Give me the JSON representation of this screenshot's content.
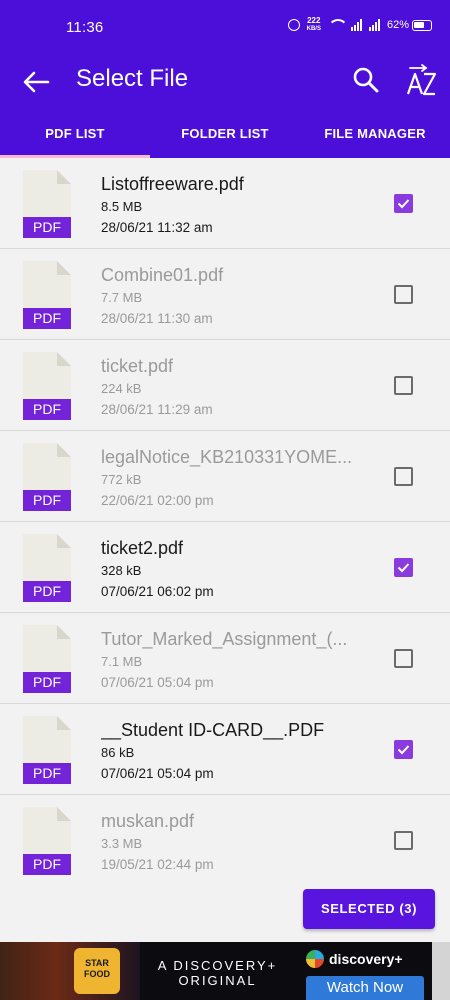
{
  "statusbar": {
    "time": "11:36",
    "speed_value": "222",
    "speed_unit": "KB/S",
    "battery": "62%"
  },
  "appbar": {
    "title": "Select File",
    "back_icon": "arrow-left-icon",
    "search_icon": "search-icon",
    "sort_icon": "sort-az-icon",
    "sort_label": "AZ"
  },
  "tabs": [
    {
      "label": "PDF LIST",
      "active": true
    },
    {
      "label": "FOLDER LIST",
      "active": false
    },
    {
      "label": "FILE MANAGER",
      "active": false
    }
  ],
  "files": [
    {
      "name": "Listoffreeware.pdf",
      "size": "8.5 MB",
      "date": "28/06/21  11:32 am",
      "checked": true
    },
    {
      "name": "Combine01.pdf",
      "size": "7.7 MB",
      "date": "28/06/21  11:30 am",
      "checked": false
    },
    {
      "name": "ticket.pdf",
      "size": "224 kB",
      "date": "28/06/21  11:29 am",
      "checked": false
    },
    {
      "name": "legalNotice_KB210331YOME...",
      "size": "772 kB",
      "date": "22/06/21  02:00 pm",
      "checked": false
    },
    {
      "name": "ticket2.pdf",
      "size": "328 kB",
      "date": "07/06/21  06:02 pm",
      "checked": true
    },
    {
      "name": "Tutor_Marked_Assignment_(...",
      "size": "7.1 MB",
      "date": "07/06/21  05:04 pm",
      "checked": false
    },
    {
      "name": "__Student ID-CARD__.PDF",
      "size": "86 kB",
      "date": "07/06/21  05:04 pm",
      "checked": true
    },
    {
      "name": "muskan.pdf",
      "size": "3.3 MB",
      "date": "19/05/21  02:44 pm",
      "checked": false
    }
  ],
  "file_type_label": "PDF",
  "selected_button": "SELECTED (3)",
  "ad": {
    "logo_text": "STAR FOOD",
    "line1": "A DISCOVERY+",
    "line2": "ORIGINAL",
    "brand": "discovery+",
    "cta": "Watch Now"
  },
  "colors": {
    "primary": "#4c0fd9",
    "checkbox": "#8a3be0",
    "pdf_label": "#7324d9",
    "tab_indicator": "#f6b8d6",
    "button": "#5a14e0"
  }
}
